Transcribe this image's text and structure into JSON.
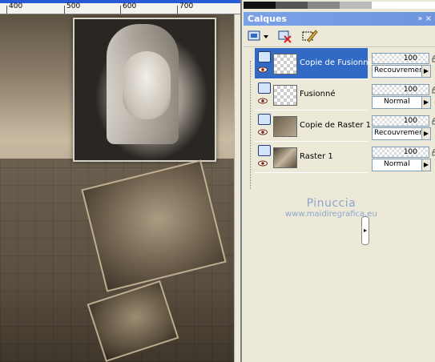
{
  "ruler": {
    "ticks": [
      "400",
      "500",
      "600",
      "700"
    ]
  },
  "panel": {
    "title": "Calques",
    "title_buttons": "» ×",
    "colors": {
      "accent": "#316ac5",
      "titlebar": "#7ba2e7",
      "canvas_accent": "#2a5bd7"
    }
  },
  "toolbar": {
    "icons": [
      "new-layer-icon",
      "delete-layer-icon",
      "mask-icon"
    ]
  },
  "layers": [
    {
      "name": "Copie de Fusionné",
      "selected": true,
      "opacity": "100",
      "blend": "Recouvrement"
    },
    {
      "name": "Fusionné",
      "selected": false,
      "opacity": "100",
      "blend": "Normal"
    },
    {
      "name": "Copie de Raster 1",
      "selected": false,
      "opacity": "100",
      "blend": "Recouvrement"
    },
    {
      "name": "Raster 1",
      "selected": false,
      "opacity": "100",
      "blend": "Normal"
    }
  ],
  "watermark": {
    "line1": "Pinuccia",
    "line2": "www.maidiregrafica.eu"
  }
}
